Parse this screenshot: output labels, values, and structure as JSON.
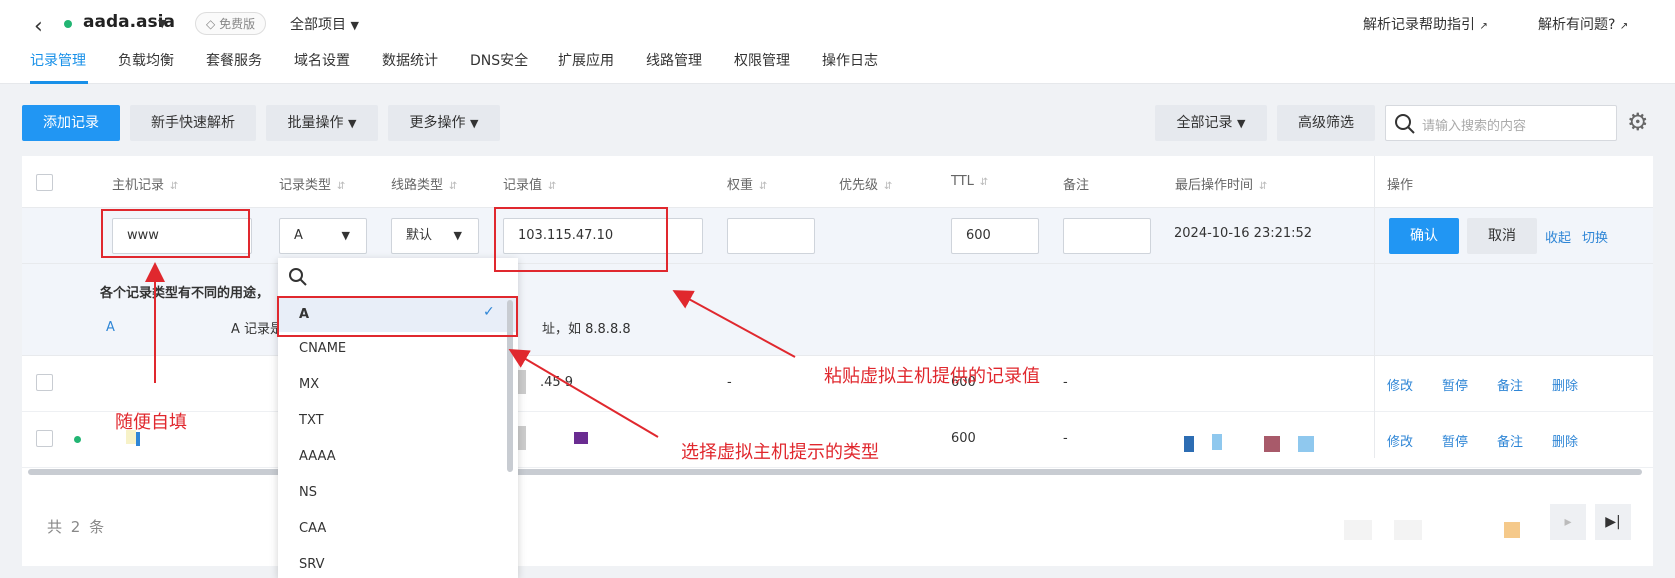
{
  "header": {
    "domain": "aada.asia",
    "badge": "免费版",
    "project": "全部项目",
    "help_link": "解析记录帮助指引",
    "problem_link": "解析有问题?"
  },
  "tabs": [
    "记录管理",
    "负载均衡",
    "套餐服务",
    "域名设置",
    "数据统计",
    "DNS安全",
    "扩展应用",
    "线路管理",
    "权限管理",
    "操作日志"
  ],
  "toolbar": {
    "add_record": "添加记录",
    "quick_guide": "新手快速解析",
    "batch": "批量操作",
    "more": "更多操作",
    "all_records": "全部记录",
    "advanced_filter": "高级筛选",
    "search_placeholder": "请输入搜索的内容"
  },
  "columns": [
    "主机记录",
    "记录类型",
    "线路类型",
    "记录值",
    "权重",
    "优先级",
    "TTL",
    "备注",
    "最后操作时间",
    "操作"
  ],
  "edit_row": {
    "host": "www",
    "type": "A",
    "line": "默认",
    "value": "103.115.47.10",
    "ttl": "600",
    "time": "2024-10-16 23:21:52",
    "confirm": "确认",
    "cancel": "取消",
    "collapse": "收起",
    "switch": "切换"
  },
  "hint": {
    "title": "各个记录类型有不同的用途，",
    "type": "A",
    "desc_prefix": "A 记录是",
    "desc_suffix": "址，如 8.8.8.8"
  },
  "rows": [
    {
      "value_frag": ".45  9",
      "weight": "-",
      "ttl": "600",
      "note": "-",
      "actions": [
        "修改",
        "暂停",
        "备注",
        "删除"
      ]
    },
    {
      "ttl": "600",
      "note": "-",
      "actions": [
        "修改",
        "暂停",
        "备注",
        "删除"
      ]
    }
  ],
  "footer": {
    "count": "共 2 条"
  },
  "dropdown": {
    "items": [
      "A",
      "CNAME",
      "MX",
      "TXT",
      "AAAA",
      "NS",
      "CAA",
      "SRV"
    ],
    "selected": "A"
  },
  "annotations": {
    "fill_any": "随便自填",
    "paste_value": "粘贴虚拟主机提供的记录值",
    "choose_type": "选择虚拟主机提示的类型"
  },
  "colors": {
    "primary": "#2196f3",
    "annotation": "#e0282e",
    "status_green": "#22b573"
  }
}
